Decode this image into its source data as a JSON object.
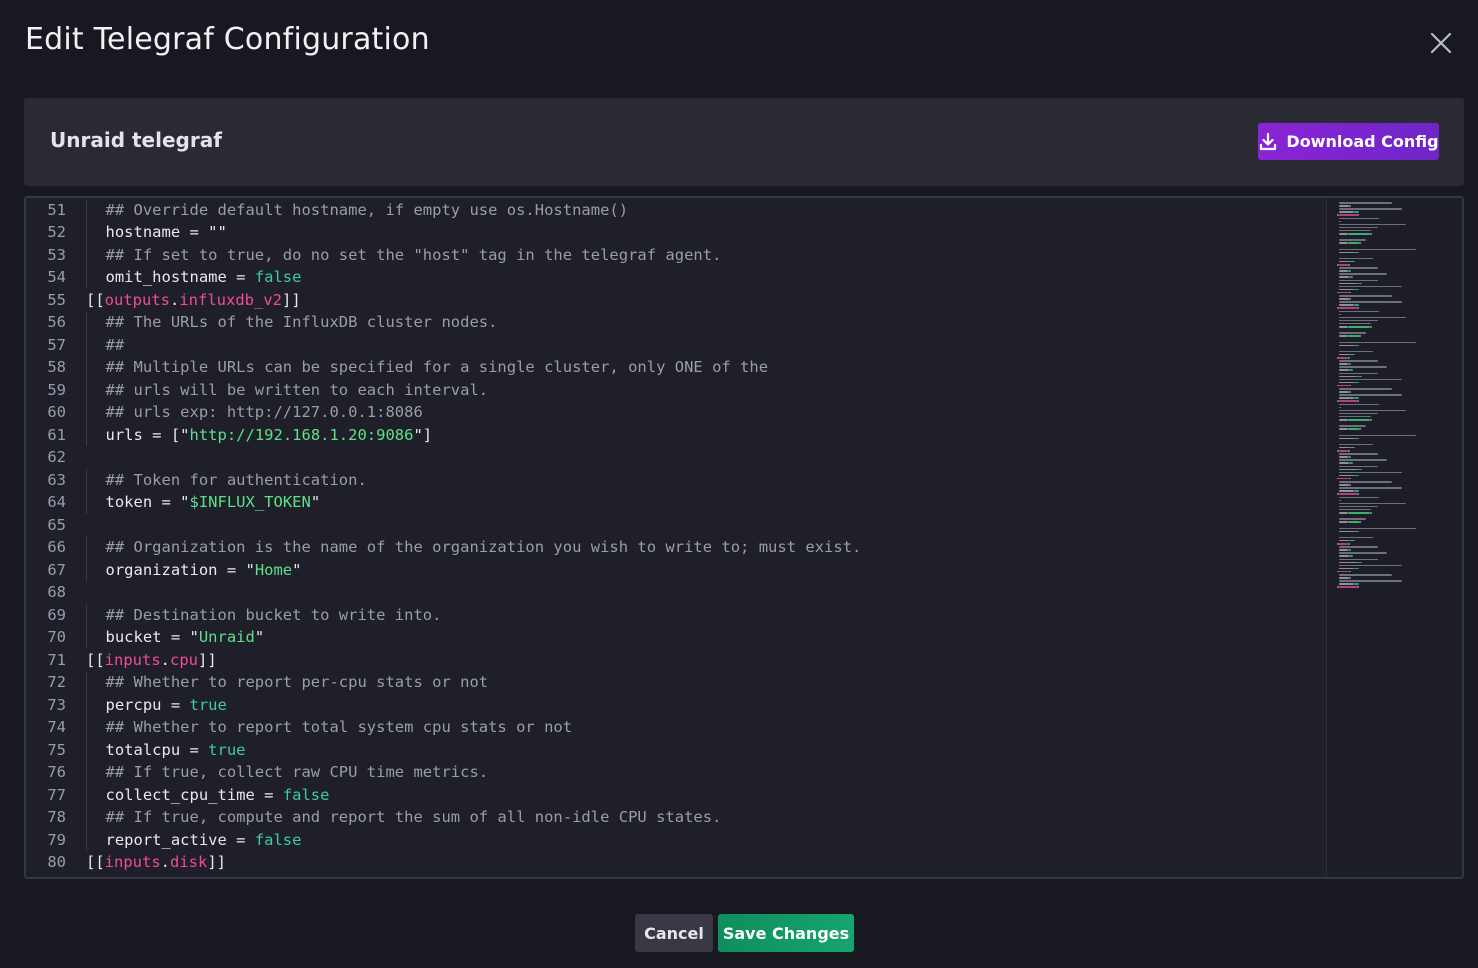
{
  "modal": {
    "title": "Edit Telegraf Configuration",
    "close_icon": "close-icon"
  },
  "config": {
    "name": "Unraid telegraf",
    "download_label": "Download Config",
    "download_icon": "download-icon"
  },
  "editor": {
    "lines": [
      {
        "num": "51",
        "indent": 1,
        "tokens": [
          {
            "t": "## Override default hostname, if empty use os.Hostname()",
            "c": "comment"
          }
        ]
      },
      {
        "num": "52",
        "indent": 1,
        "tokens": [
          {
            "t": "hostname = ",
            "c": "key"
          },
          {
            "t": "\"\"",
            "c": "key"
          }
        ]
      },
      {
        "num": "53",
        "indent": 1,
        "tokens": [
          {
            "t": "## If set to true, do no set the \"host\" tag in the telegraf agent.",
            "c": "comment"
          }
        ]
      },
      {
        "num": "54",
        "indent": 1,
        "tokens": [
          {
            "t": "omit_hostname = ",
            "c": "key"
          },
          {
            "t": "false",
            "c": "bool"
          }
        ]
      },
      {
        "num": "55",
        "indent": 0,
        "tokens": [
          {
            "t": "[[",
            "c": "punc"
          },
          {
            "t": "outputs",
            "c": "sect"
          },
          {
            "t": ".",
            "c": "punc"
          },
          {
            "t": "influxdb_v2",
            "c": "sect"
          },
          {
            "t": "]]",
            "c": "punc"
          }
        ]
      },
      {
        "num": "56",
        "indent": 1,
        "tokens": [
          {
            "t": "## The URLs of the InfluxDB cluster nodes.",
            "c": "comment"
          }
        ]
      },
      {
        "num": "57",
        "indent": 1,
        "tokens": [
          {
            "t": "##",
            "c": "comment"
          }
        ]
      },
      {
        "num": "58",
        "indent": 1,
        "tokens": [
          {
            "t": "## Multiple URLs can be specified for a single cluster, only ONE of the",
            "c": "comment"
          }
        ]
      },
      {
        "num": "59",
        "indent": 1,
        "tokens": [
          {
            "t": "## urls will be written to each interval.",
            "c": "comment"
          }
        ]
      },
      {
        "num": "60",
        "indent": 1,
        "tokens": [
          {
            "t": "## urls exp: http://127.0.0.1:8086",
            "c": "comment"
          }
        ]
      },
      {
        "num": "61",
        "indent": 1,
        "tokens": [
          {
            "t": "urls = [\"",
            "c": "key"
          },
          {
            "t": "http://192.168.1.20:9086",
            "c": "str"
          },
          {
            "t": "\"]",
            "c": "key"
          }
        ]
      },
      {
        "num": "62",
        "indent": 0,
        "tokens": []
      },
      {
        "num": "63",
        "indent": 1,
        "tokens": [
          {
            "t": "## Token for authentication.",
            "c": "comment"
          }
        ]
      },
      {
        "num": "64",
        "indent": 1,
        "tokens": [
          {
            "t": "token = \"",
            "c": "key"
          },
          {
            "t": "$INFLUX_TOKEN",
            "c": "str"
          },
          {
            "t": "\"",
            "c": "key"
          }
        ]
      },
      {
        "num": "65",
        "indent": 0,
        "tokens": []
      },
      {
        "num": "66",
        "indent": 1,
        "tokens": [
          {
            "t": "## Organization is the name of the organization you wish to write to; must exist.",
            "c": "comment"
          }
        ]
      },
      {
        "num": "67",
        "indent": 1,
        "tokens": [
          {
            "t": "organization = \"",
            "c": "key"
          },
          {
            "t": "Home",
            "c": "str"
          },
          {
            "t": "\"",
            "c": "key"
          }
        ]
      },
      {
        "num": "68",
        "indent": 0,
        "tokens": []
      },
      {
        "num": "69",
        "indent": 1,
        "tokens": [
          {
            "t": "## Destination bucket to write into.",
            "c": "comment"
          }
        ]
      },
      {
        "num": "70",
        "indent": 1,
        "tokens": [
          {
            "t": "bucket = \"",
            "c": "key"
          },
          {
            "t": "Unraid",
            "c": "str"
          },
          {
            "t": "\"",
            "c": "key"
          }
        ]
      },
      {
        "num": "71",
        "indent": 0,
        "tokens": [
          {
            "t": "[[",
            "c": "punc"
          },
          {
            "t": "inputs",
            "c": "sect"
          },
          {
            "t": ".",
            "c": "punc"
          },
          {
            "t": "cpu",
            "c": "sect"
          },
          {
            "t": "]]",
            "c": "punc"
          }
        ]
      },
      {
        "num": "72",
        "indent": 1,
        "tokens": [
          {
            "t": "## Whether to report per-cpu stats or not",
            "c": "comment"
          }
        ]
      },
      {
        "num": "73",
        "indent": 1,
        "tokens": [
          {
            "t": "percpu = ",
            "c": "key"
          },
          {
            "t": "true",
            "c": "bool"
          }
        ]
      },
      {
        "num": "74",
        "indent": 1,
        "tokens": [
          {
            "t": "## Whether to report total system cpu stats or not",
            "c": "comment"
          }
        ]
      },
      {
        "num": "75",
        "indent": 1,
        "tokens": [
          {
            "t": "totalcpu = ",
            "c": "key"
          },
          {
            "t": "true",
            "c": "bool"
          }
        ]
      },
      {
        "num": "76",
        "indent": 1,
        "tokens": [
          {
            "t": "## If true, collect raw CPU time metrics.",
            "c": "comment"
          }
        ]
      },
      {
        "num": "77",
        "indent": 1,
        "tokens": [
          {
            "t": "collect_cpu_time = ",
            "c": "key"
          },
          {
            "t": "false",
            "c": "bool"
          }
        ]
      },
      {
        "num": "78",
        "indent": 1,
        "tokens": [
          {
            "t": "## If true, compute and report the sum of all non-idle CPU states.",
            "c": "comment"
          }
        ]
      },
      {
        "num": "79",
        "indent": 1,
        "tokens": [
          {
            "t": "report_active = ",
            "c": "key"
          },
          {
            "t": "false",
            "c": "bool"
          }
        ]
      },
      {
        "num": "80",
        "indent": 0,
        "tokens": [
          {
            "t": "[[",
            "c": "punc"
          },
          {
            "t": "inputs",
            "c": "sect"
          },
          {
            "t": ".",
            "c": "punc"
          },
          {
            "t": "disk",
            "c": "sect"
          },
          {
            "t": "]]",
            "c": "punc"
          }
        ]
      }
    ]
  },
  "footer": {
    "cancel_label": "Cancel",
    "save_label": "Save Changes"
  },
  "colors": {
    "download_accent": "#7b25cf",
    "save_accent": "#13a06c",
    "section": "#f04b9a",
    "string": "#5ee08a",
    "boolean": "#3ec9a8"
  }
}
